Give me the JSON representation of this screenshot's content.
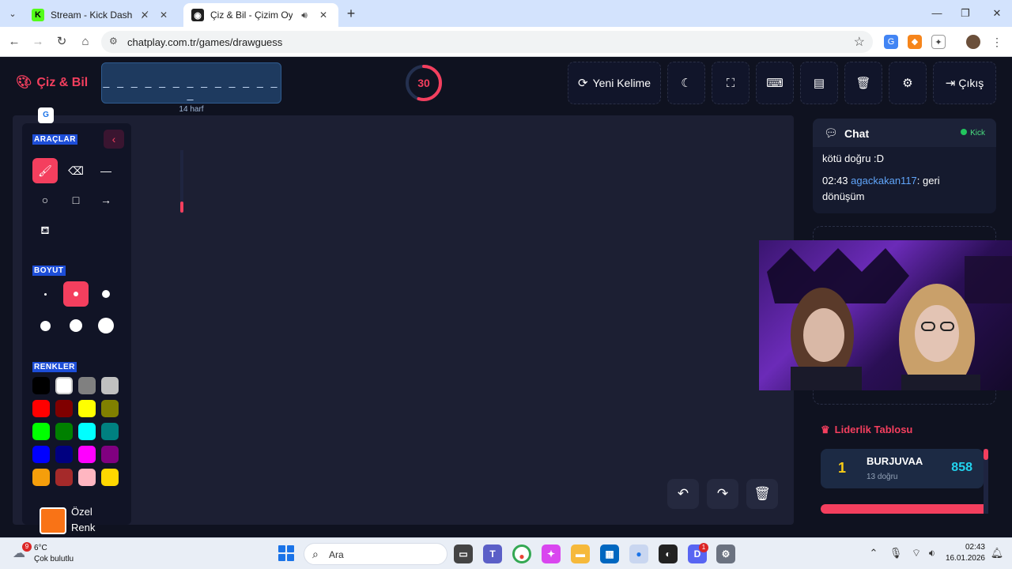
{
  "browser": {
    "tabs": [
      {
        "title": "Stream - Kick Dashboard",
        "favicon": "kick-icon",
        "accent": "#53fc18",
        "state": "muted"
      },
      {
        "title": "Çiz & Bil - Çizim Oyunu",
        "favicon": "gamepad-icon",
        "accent": "#1f1f1f",
        "state": "playing-audio",
        "active": true
      }
    ],
    "url": "chatplay.com.tr/games/drawguess"
  },
  "header": {
    "logo": "Çiz & Bil",
    "word_dashes": "_ _ _ _ _ _ _ _ _ _ _ _ _ _",
    "word_length_label": "14 harf",
    "timer": "30",
    "timer_fraction": 0.55,
    "new_word_label": "Yeni Kelime",
    "exit_label": "Çıkış",
    "buttons": [
      "moon-icon",
      "fullscreen-icon",
      "keyboard-icon",
      "archive-icon",
      "trash-icon",
      "gear-icon"
    ]
  },
  "tools": {
    "tools_title": "ARAÇLAR",
    "size_title": "BOYUT",
    "colors_title": "RENKLER",
    "tool_items": [
      "brush-icon",
      "eraser-icon",
      "line-icon",
      "circle-icon",
      "rectangle-icon",
      "arrow-icon",
      "fill-bucket-icon"
    ],
    "active_tool": "brush-icon",
    "active_size": 1,
    "colors": [
      "#000000",
      "#ffffff",
      "#808080",
      "#c0c0c0",
      "#ff0000",
      "#800000",
      "#ffff00",
      "#808000",
      "#00ff00",
      "#008000",
      "#00ffff",
      "#008080",
      "#0000ff",
      "#000080",
      "#ff00ff",
      "#800080",
      "#f59e0b",
      "#a52a2a",
      "#ffb6c1",
      "#ffd700"
    ],
    "custom_color_label": "Özel Renk",
    "custom_color": "#f97316"
  },
  "chat": {
    "title": "Chat",
    "platform": "Kick",
    "messages": [
      {
        "text": "kötü doğru :D"
      },
      {
        "time": "02:43",
        "user": "agackakan117",
        "text": ": geri dönüşüm"
      }
    ]
  },
  "leaderboard": {
    "title": "Liderlik Tablosu",
    "entries": [
      {
        "rank": "1",
        "name": "BURJUVAA",
        "sub": "13 doğru",
        "score": "858"
      }
    ]
  },
  "taskbar": {
    "weather_badge": "9",
    "temperature": "6°C",
    "weather_desc": "Çok bulutlu",
    "search_placeholder": "Ara",
    "discord_badge": "1",
    "time": "02:43",
    "date": "16.01.2026"
  }
}
